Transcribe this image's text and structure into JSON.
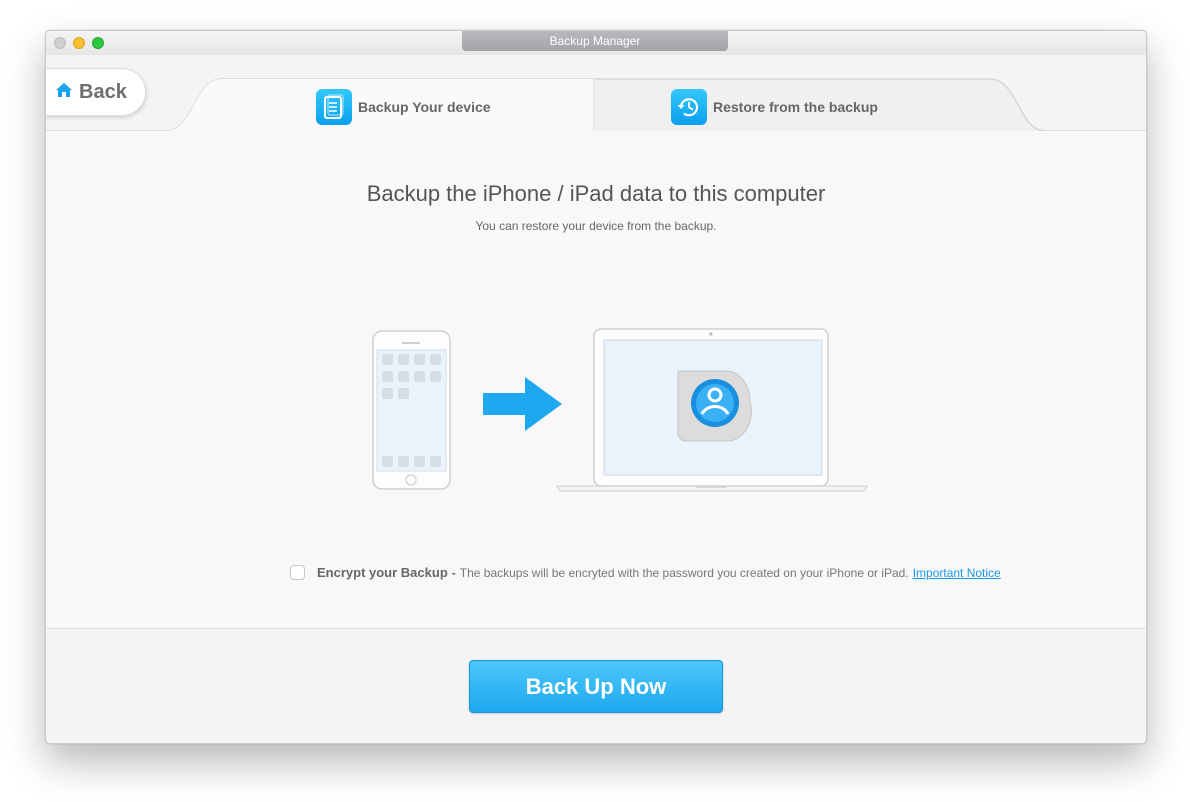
{
  "window": {
    "title": "Backup Manager"
  },
  "header": {
    "back_label": "Back",
    "tabs": [
      {
        "label": "Backup Your device",
        "icon": "backup-document-icon",
        "active": true
      },
      {
        "label": "Restore from the backup",
        "icon": "restore-clock-icon",
        "active": false
      }
    ]
  },
  "main": {
    "heading": "Backup the iPhone / iPad data to this computer",
    "subheading": "You can restore your device from the backup.",
    "encrypt": {
      "title": "Encrypt your Backup",
      "dash": "-",
      "description": "The backups will be encryted with the password you created on your iPhone or iPad.",
      "link": "Important Notice",
      "checked": false
    }
  },
  "footer": {
    "button_label": "Back Up Now"
  },
  "colors": {
    "accent": "#1ea8ef",
    "link": "#1a98e8"
  }
}
